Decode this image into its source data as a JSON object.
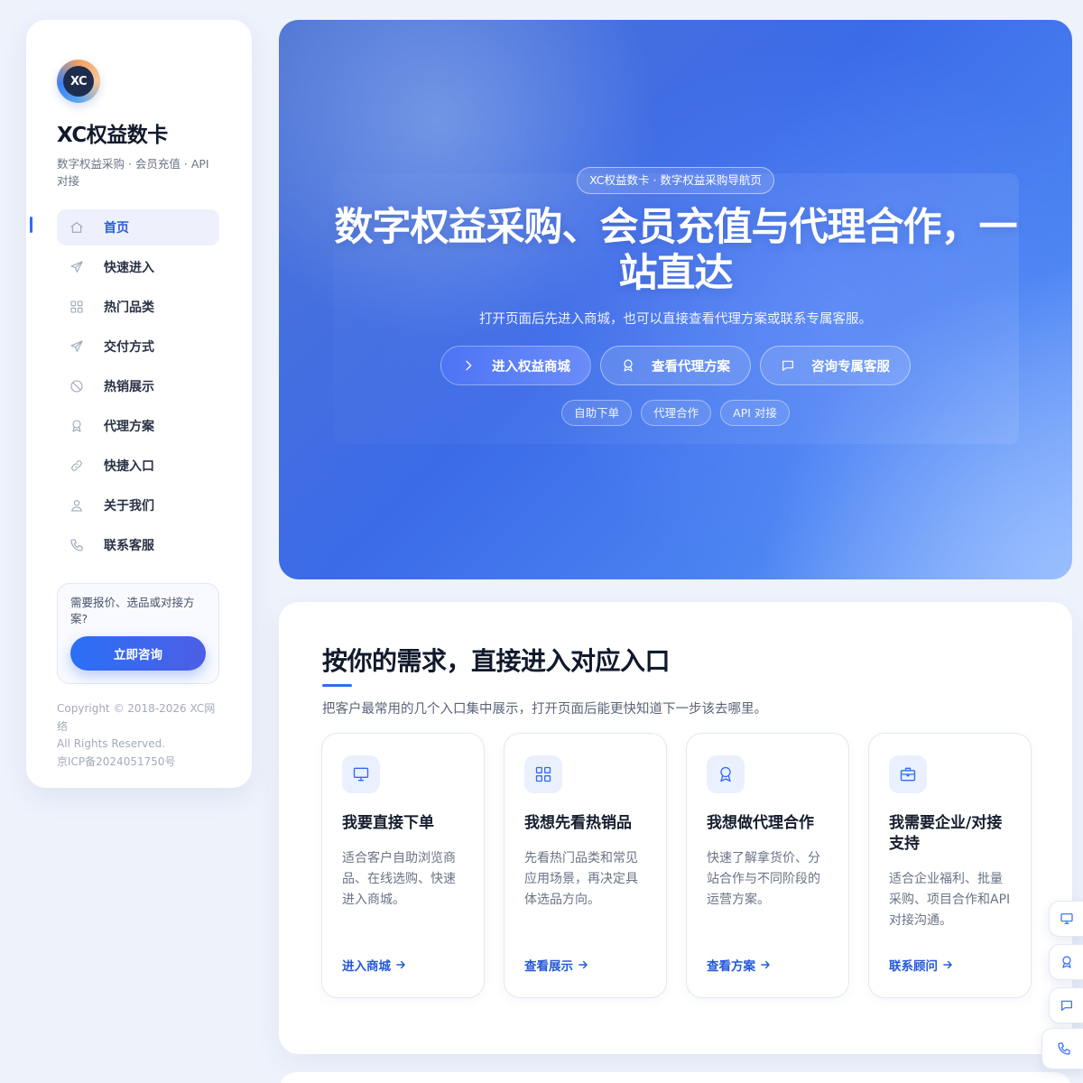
{
  "sidebar": {
    "logo_text": "XC",
    "brand_name": "XC权益数卡",
    "brand_sub": "数字权益采购 · 会员充值 · API对接",
    "nav": [
      {
        "label": "首页",
        "icon": "home-icon"
      },
      {
        "label": "快速进入",
        "icon": "send-icon"
      },
      {
        "label": "热门品类",
        "icon": "grid-icon"
      },
      {
        "label": "交付方式",
        "icon": "send-icon"
      },
      {
        "label": "热销展示",
        "icon": "badge-icon"
      },
      {
        "label": "代理方案",
        "icon": "award-icon"
      },
      {
        "label": "快捷入口",
        "icon": "link-icon"
      },
      {
        "label": "关于我们",
        "icon": "user-icon"
      },
      {
        "label": "联系客服",
        "icon": "phone-icon"
      }
    ],
    "consult_text": "需要报价、选品或对接方案?",
    "consult_button": "立即咨询",
    "copyright": [
      "Copyright © 2018-2026 XC网络",
      "All Rights Reserved.",
      "京ICP备2024051750号"
    ]
  },
  "hero": {
    "pill": "XC权益数卡 · 数字权益采购导航页",
    "title": "数字权益采购、会员充值与代理合作，一站直达",
    "desc": "打开页面后先进入商城，也可以直接查看代理方案或联系专属客服。",
    "buttons": [
      {
        "label": "进入权益商城",
        "icon": "chevron-right-icon"
      },
      {
        "label": "查看代理方案",
        "icon": "award-icon"
      },
      {
        "label": "咨询专属客服",
        "icon": "chat-icon"
      }
    ],
    "tags": [
      "自助下单",
      "代理合作",
      "API 对接"
    ]
  },
  "entry": {
    "title": "按你的需求，直接进入对应入口",
    "desc": "把客户最常用的几个入口集中展示，打开页面后能更快知道下一步该去哪里。",
    "cards": [
      {
        "icon": "monitor-icon",
        "title": "我要直接下单",
        "desc": "适合客户自助浏览商品、在线选购、快速进入商城。",
        "link": "进入商城"
      },
      {
        "icon": "grid-icon",
        "title": "我想先看热销品",
        "desc": "先看热门品类和常见应用场景，再决定具体选品方向。",
        "link": "查看展示"
      },
      {
        "icon": "award-icon",
        "title": "我想做代理合作",
        "desc": "快速了解拿货价、分站合作与不同阶段的运营方案。",
        "link": "查看方案"
      },
      {
        "icon": "briefcase-icon",
        "title": "我需要企业/对接支持",
        "desc": "适合企业福利、批量采购、项目合作和API对接沟通。",
        "link": "联系顾问"
      }
    ]
  },
  "floating": [
    "monitor-icon",
    "award-icon",
    "chat-icon",
    "phone-icon"
  ],
  "colors": {
    "accent": "#2f6cf2",
    "hero_start": "#4e74d4",
    "hero_end": "#7aa7fb"
  }
}
